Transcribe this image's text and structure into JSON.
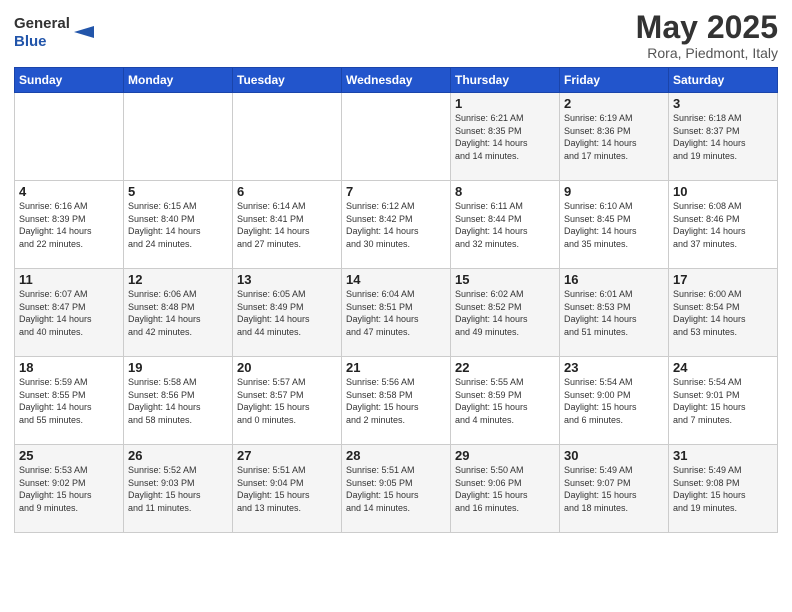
{
  "header": {
    "logo_general": "General",
    "logo_blue": "Blue",
    "month_title": "May 2025",
    "location": "Rora, Piedmont, Italy"
  },
  "weekdays": [
    "Sunday",
    "Monday",
    "Tuesday",
    "Wednesday",
    "Thursday",
    "Friday",
    "Saturday"
  ],
  "weeks": [
    [
      {
        "day": "",
        "info": ""
      },
      {
        "day": "",
        "info": ""
      },
      {
        "day": "",
        "info": ""
      },
      {
        "day": "",
        "info": ""
      },
      {
        "day": "1",
        "info": "Sunrise: 6:21 AM\nSunset: 8:35 PM\nDaylight: 14 hours\nand 14 minutes."
      },
      {
        "day": "2",
        "info": "Sunrise: 6:19 AM\nSunset: 8:36 PM\nDaylight: 14 hours\nand 17 minutes."
      },
      {
        "day": "3",
        "info": "Sunrise: 6:18 AM\nSunset: 8:37 PM\nDaylight: 14 hours\nand 19 minutes."
      }
    ],
    [
      {
        "day": "4",
        "info": "Sunrise: 6:16 AM\nSunset: 8:39 PM\nDaylight: 14 hours\nand 22 minutes."
      },
      {
        "day": "5",
        "info": "Sunrise: 6:15 AM\nSunset: 8:40 PM\nDaylight: 14 hours\nand 24 minutes."
      },
      {
        "day": "6",
        "info": "Sunrise: 6:14 AM\nSunset: 8:41 PM\nDaylight: 14 hours\nand 27 minutes."
      },
      {
        "day": "7",
        "info": "Sunrise: 6:12 AM\nSunset: 8:42 PM\nDaylight: 14 hours\nand 30 minutes."
      },
      {
        "day": "8",
        "info": "Sunrise: 6:11 AM\nSunset: 8:44 PM\nDaylight: 14 hours\nand 32 minutes."
      },
      {
        "day": "9",
        "info": "Sunrise: 6:10 AM\nSunset: 8:45 PM\nDaylight: 14 hours\nand 35 minutes."
      },
      {
        "day": "10",
        "info": "Sunrise: 6:08 AM\nSunset: 8:46 PM\nDaylight: 14 hours\nand 37 minutes."
      }
    ],
    [
      {
        "day": "11",
        "info": "Sunrise: 6:07 AM\nSunset: 8:47 PM\nDaylight: 14 hours\nand 40 minutes."
      },
      {
        "day": "12",
        "info": "Sunrise: 6:06 AM\nSunset: 8:48 PM\nDaylight: 14 hours\nand 42 minutes."
      },
      {
        "day": "13",
        "info": "Sunrise: 6:05 AM\nSunset: 8:49 PM\nDaylight: 14 hours\nand 44 minutes."
      },
      {
        "day": "14",
        "info": "Sunrise: 6:04 AM\nSunset: 8:51 PM\nDaylight: 14 hours\nand 47 minutes."
      },
      {
        "day": "15",
        "info": "Sunrise: 6:02 AM\nSunset: 8:52 PM\nDaylight: 14 hours\nand 49 minutes."
      },
      {
        "day": "16",
        "info": "Sunrise: 6:01 AM\nSunset: 8:53 PM\nDaylight: 14 hours\nand 51 minutes."
      },
      {
        "day": "17",
        "info": "Sunrise: 6:00 AM\nSunset: 8:54 PM\nDaylight: 14 hours\nand 53 minutes."
      }
    ],
    [
      {
        "day": "18",
        "info": "Sunrise: 5:59 AM\nSunset: 8:55 PM\nDaylight: 14 hours\nand 55 minutes."
      },
      {
        "day": "19",
        "info": "Sunrise: 5:58 AM\nSunset: 8:56 PM\nDaylight: 14 hours\nand 58 minutes."
      },
      {
        "day": "20",
        "info": "Sunrise: 5:57 AM\nSunset: 8:57 PM\nDaylight: 15 hours\nand 0 minutes."
      },
      {
        "day": "21",
        "info": "Sunrise: 5:56 AM\nSunset: 8:58 PM\nDaylight: 15 hours\nand 2 minutes."
      },
      {
        "day": "22",
        "info": "Sunrise: 5:55 AM\nSunset: 8:59 PM\nDaylight: 15 hours\nand 4 minutes."
      },
      {
        "day": "23",
        "info": "Sunrise: 5:54 AM\nSunset: 9:00 PM\nDaylight: 15 hours\nand 6 minutes."
      },
      {
        "day": "24",
        "info": "Sunrise: 5:54 AM\nSunset: 9:01 PM\nDaylight: 15 hours\nand 7 minutes."
      }
    ],
    [
      {
        "day": "25",
        "info": "Sunrise: 5:53 AM\nSunset: 9:02 PM\nDaylight: 15 hours\nand 9 minutes."
      },
      {
        "day": "26",
        "info": "Sunrise: 5:52 AM\nSunset: 9:03 PM\nDaylight: 15 hours\nand 11 minutes."
      },
      {
        "day": "27",
        "info": "Sunrise: 5:51 AM\nSunset: 9:04 PM\nDaylight: 15 hours\nand 13 minutes."
      },
      {
        "day": "28",
        "info": "Sunrise: 5:51 AM\nSunset: 9:05 PM\nDaylight: 15 hours\nand 14 minutes."
      },
      {
        "day": "29",
        "info": "Sunrise: 5:50 AM\nSunset: 9:06 PM\nDaylight: 15 hours\nand 16 minutes."
      },
      {
        "day": "30",
        "info": "Sunrise: 5:49 AM\nSunset: 9:07 PM\nDaylight: 15 hours\nand 18 minutes."
      },
      {
        "day": "31",
        "info": "Sunrise: 5:49 AM\nSunset: 9:08 PM\nDaylight: 15 hours\nand 19 minutes."
      }
    ]
  ]
}
